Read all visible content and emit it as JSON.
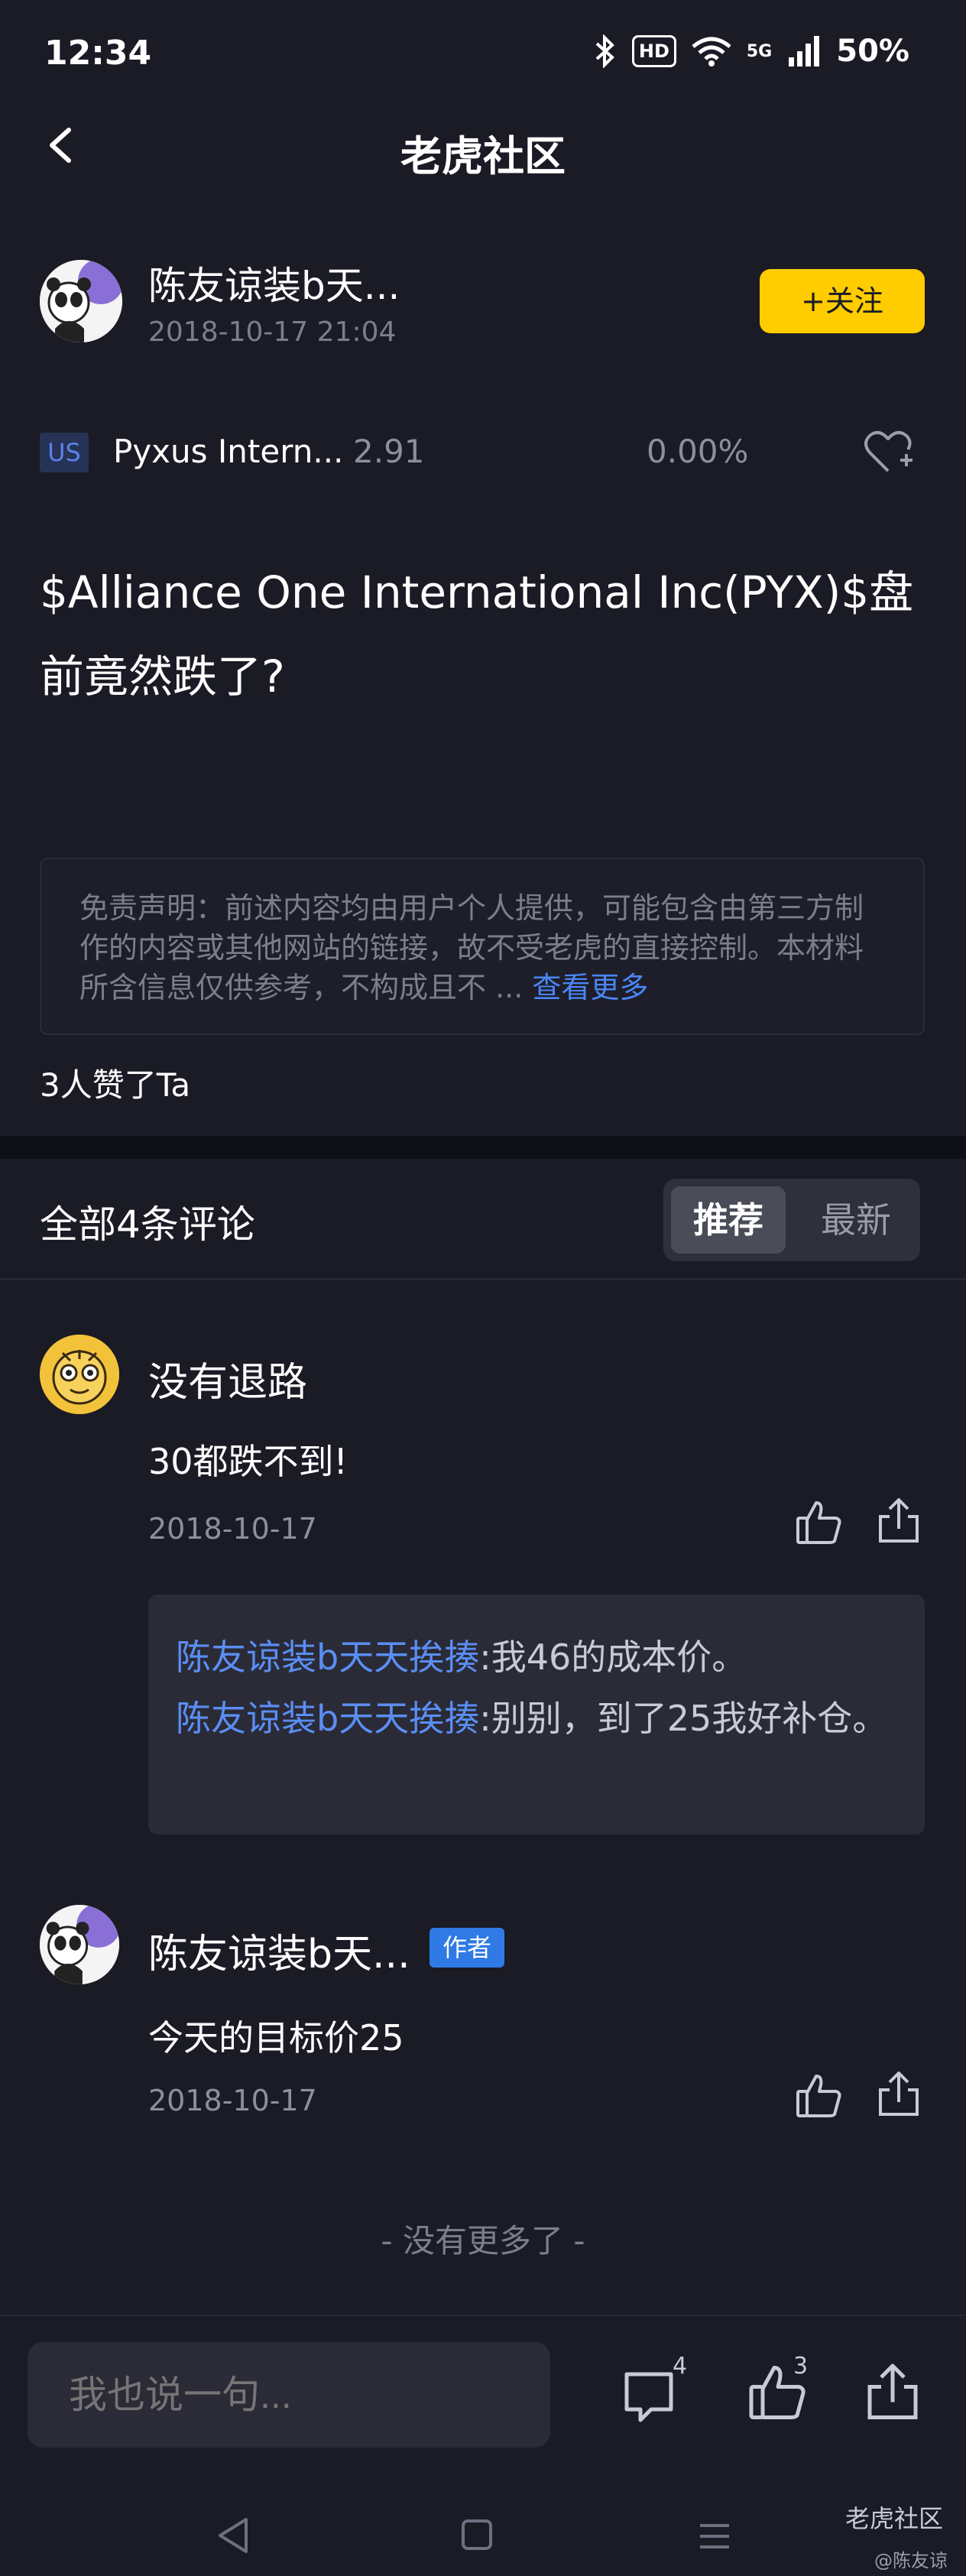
{
  "status_bar": {
    "time": "12:34",
    "battery": "50%",
    "hd": "HD",
    "network": "5G"
  },
  "header": {
    "title": "老虎社区"
  },
  "post": {
    "author": "陈友谅装b天...",
    "date": "2018-10-17 21:04",
    "follow_label": "+关注",
    "stock": {
      "market": "US",
      "name": "Pyxus Intern...",
      "price": "2.91",
      "change": "0.00%"
    },
    "content": "$Alliance One International Inc(PYX)$盘前竟然跌了?",
    "disclaimer": "免责声明：前述内容均由用户个人提供，可能包含由第三方制作的内容或其他网站的链接，故不受老虎的直接控制。本材料所含信息仅供参考，不构成且不 ...",
    "disclaimer_more": "查看更多",
    "likes_text": "3人赞了Ta"
  },
  "comments_section": {
    "title": "全部4条评论",
    "sort_tabs": [
      {
        "label": "推荐",
        "active": true
      },
      {
        "label": "最新",
        "active": false
      }
    ],
    "comments": [
      {
        "name": "没有退路",
        "text": "30都跌不到!",
        "date": "2018-10-17",
        "replies": [
          {
            "name": "陈友谅装b天天挨揍",
            "sep": ":",
            "text": "我46的成本价。"
          },
          {
            "name": "陈友谅装b天天挨揍",
            "sep": ":",
            "text": "别别，到了25我好补仓。"
          }
        ]
      },
      {
        "name": "陈友谅装b天...",
        "badge": "作者",
        "text": "今天的目标价25",
        "date": "2018-10-17"
      }
    ],
    "no_more": "- 没有更多了 -"
  },
  "bottom_bar": {
    "input_placeholder": "我也说一句...",
    "comment_count": "4",
    "like_count": "3"
  },
  "watermark": {
    "brand": "老虎社区",
    "user": "@陈友谅"
  },
  "colors": {
    "background": "#1a1b25",
    "accent_yellow": "#ffcc00",
    "link_blue": "#5b8ef3",
    "author_badge": "#2f7ae5"
  }
}
